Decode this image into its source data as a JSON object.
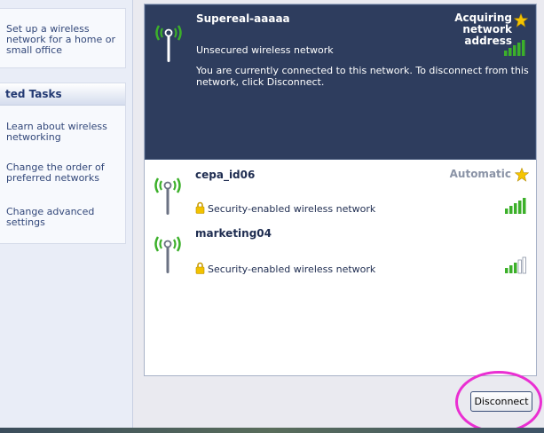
{
  "network_tasks": {
    "setup_link": "Set up a wireless network for a home or small office"
  },
  "related_tasks": {
    "header": "ted Tasks",
    "links": [
      "Learn about wireless networking",
      "Change the order of preferred networks",
      "Change advanced settings"
    ]
  },
  "networks": [
    {
      "name": "Supereal-aaaaa",
      "status": "Acquiring network address",
      "security": "Unsecured wireless network",
      "message": "You are currently connected to this network. To disconnect from this network, click Disconnect.",
      "signal_bars": 5,
      "selected": true
    },
    {
      "name": "cepa_id06",
      "status": "Automatic",
      "security": "Security-enabled wireless network",
      "signal_bars": 5,
      "selected": false
    },
    {
      "name": "marketing04",
      "status": "",
      "security": "Security-enabled wireless network",
      "signal_bars": 3,
      "selected": false
    }
  ],
  "actions": {
    "disconnect_label": "Disconnect"
  },
  "colors": {
    "selected_bg": "#2e3d5e",
    "signal_green": "#3cb02a",
    "star_gold": "#f5c400",
    "highlight": "#ea2fd2"
  }
}
